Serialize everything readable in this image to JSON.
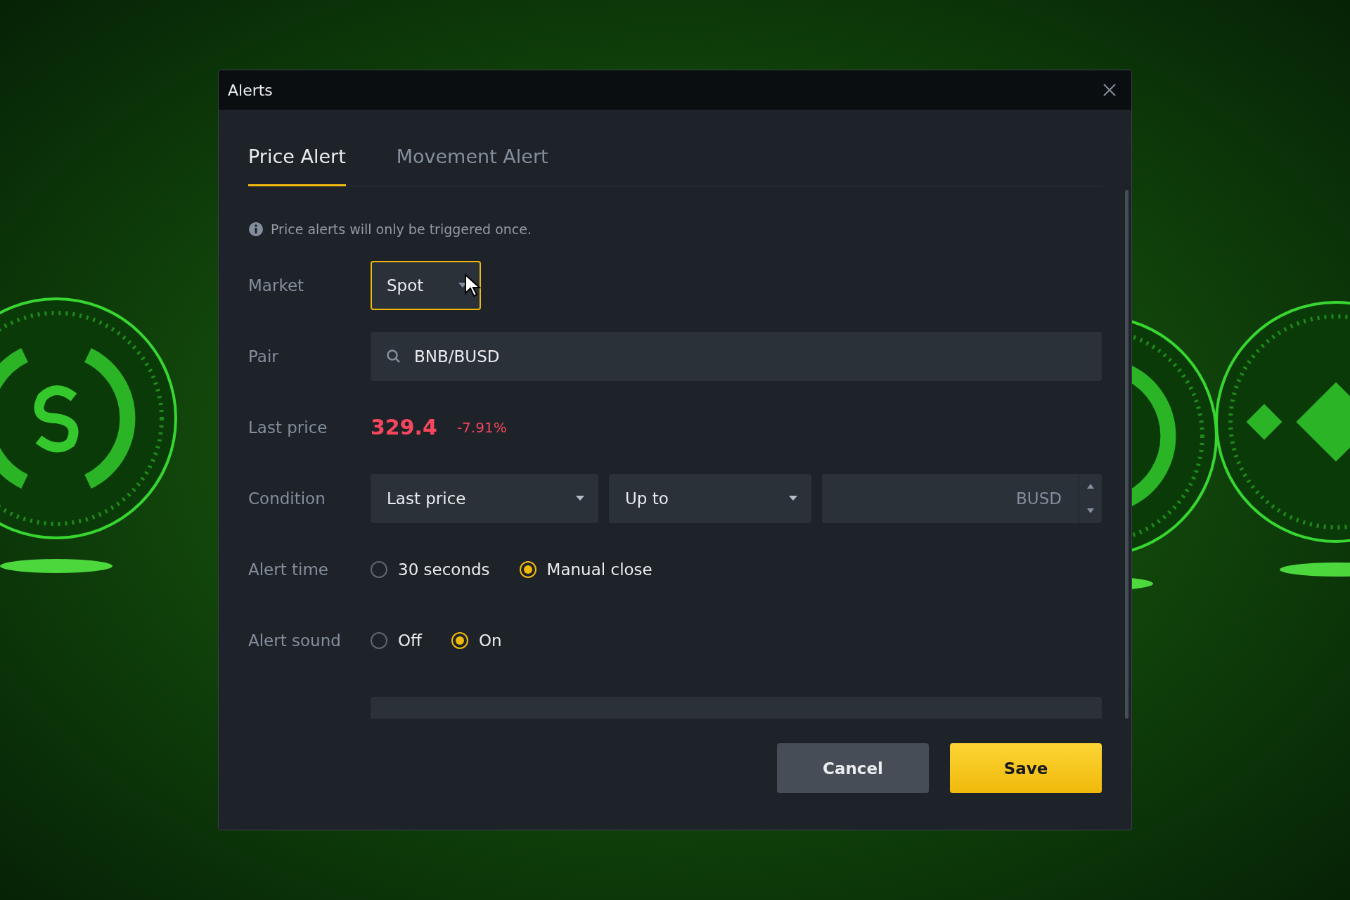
{
  "window": {
    "title": "Alerts"
  },
  "tabs": [
    {
      "label": "Price Alert",
      "selected": true
    },
    {
      "label": "Movement Alert",
      "selected": false
    }
  ],
  "notice": "Price alerts will only be triggered once.",
  "market": {
    "label": "Market",
    "value": "Spot"
  },
  "pair": {
    "label": "Pair",
    "value": "BNB/BUSD"
  },
  "last_price": {
    "label": "Last price",
    "price": "329.4",
    "change": "-7.91%"
  },
  "condition": {
    "label": "Condition",
    "field": "Last price",
    "direction": "Up to",
    "unit": "BUSD"
  },
  "alert_time": {
    "label": "Alert time",
    "options": [
      {
        "label": "30 seconds",
        "selected": false
      },
      {
        "label": "Manual close",
        "selected": true
      }
    ]
  },
  "alert_sound": {
    "label": "Alert sound",
    "options": [
      {
        "label": "Off",
        "selected": false
      },
      {
        "label": "On",
        "selected": true
      }
    ]
  },
  "buttons": [
    {
      "label": "Cancel",
      "kind": "secondary"
    },
    {
      "label": "Save",
      "kind": "primary"
    }
  ]
}
